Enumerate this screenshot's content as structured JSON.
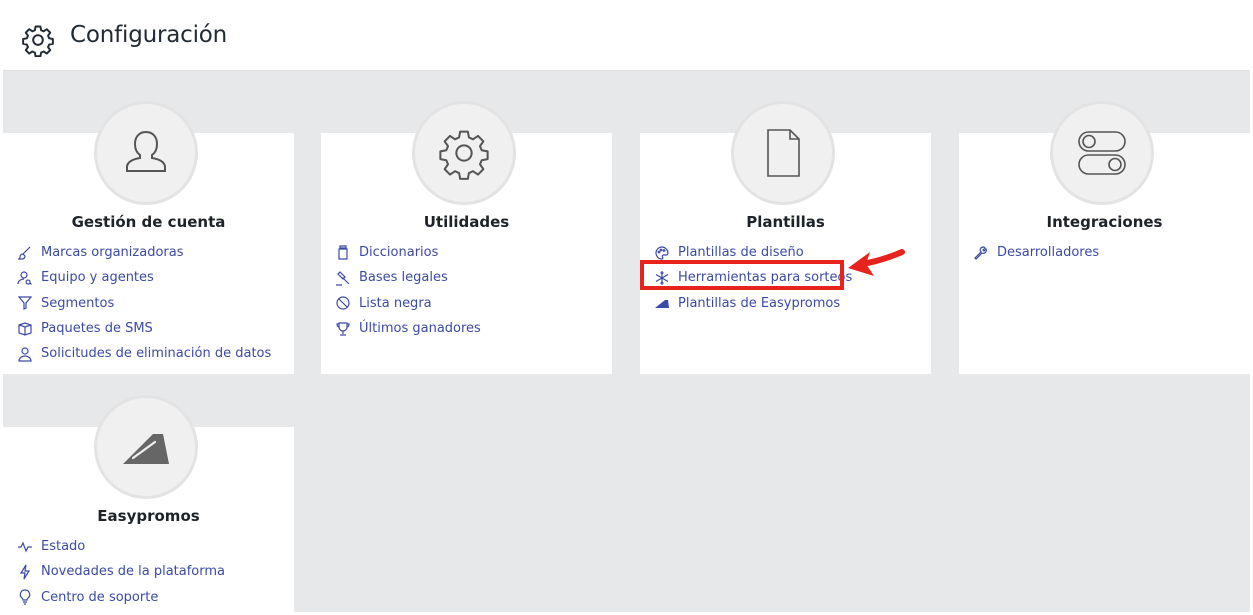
{
  "header": {
    "title": "Configuración",
    "icon": "gear-icon"
  },
  "cards": [
    {
      "title": "Gestión de cuenta",
      "icon": "user-icon",
      "items": [
        {
          "label": "Marcas organizadoras",
          "icon": "brush-icon"
        },
        {
          "label": "Equipo y agentes",
          "icon": "user-search-icon"
        },
        {
          "label": "Segmentos",
          "icon": "filter-icon"
        },
        {
          "label": "Paquetes de SMS",
          "icon": "package-icon"
        },
        {
          "label": "Solicitudes de eliminación de datos",
          "icon": "user-outline-icon"
        }
      ]
    },
    {
      "title": "Utilidades",
      "icon": "gear-icon",
      "items": [
        {
          "label": "Diccionarios",
          "icon": "jar-icon"
        },
        {
          "label": "Bases legales",
          "icon": "gavel-icon"
        },
        {
          "label": "Lista negra",
          "icon": "block-icon"
        },
        {
          "label": "Últimos ganadores",
          "icon": "trophy-icon"
        }
      ]
    },
    {
      "title": "Plantillas",
      "icon": "document-icon",
      "items": [
        {
          "label": "Plantillas de diseño",
          "icon": "palette-icon"
        },
        {
          "label": "Herramientas para sorteos",
          "icon": "snowflake-icon"
        },
        {
          "label": "Plantillas de Easypromos",
          "icon": "easypromos-icon"
        }
      ]
    },
    {
      "title": "Integraciones",
      "icon": "toggles-icon",
      "items": [
        {
          "label": "Desarrolladores",
          "icon": "wrench-icon"
        }
      ]
    },
    {
      "title": "Easypromos",
      "icon": "easypromos-logo-icon",
      "items": [
        {
          "label": "Estado",
          "icon": "heartbeat-icon"
        },
        {
          "label": "Novedades de la plataforma",
          "icon": "lightning-icon"
        },
        {
          "label": "Centro de soporte",
          "icon": "lightbulb-icon"
        }
      ]
    }
  ],
  "colors": {
    "link": "#3c4aa5",
    "highlight": "#e8231e",
    "background": "#e7e8ea"
  }
}
